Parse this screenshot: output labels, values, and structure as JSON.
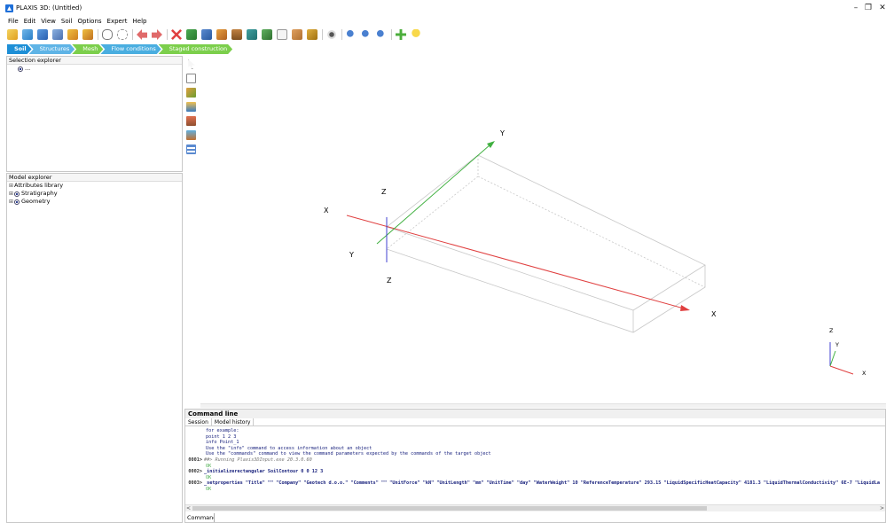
{
  "window": {
    "title": "PLAXIS 3D: (Untitled)",
    "minimize_glyph": "–",
    "restore_glyph": "❐",
    "close_glyph": "✕"
  },
  "menu": [
    "File",
    "Edit",
    "View",
    "Soil",
    "Options",
    "Expert",
    "Help"
  ],
  "toolbar": {
    "icons": [
      "new-project-icon",
      "open-project-icon",
      "save-icon",
      "save-as-icon",
      "import-icon",
      "export-icon",
      "link-icon",
      "unlink-icon",
      "undo-icon",
      "redo-icon",
      "delete-icon",
      "calculate-icon",
      "print-icon",
      "soil-icon",
      "borehole-icon",
      "structure-icon",
      "mesh-icon",
      "box-icon",
      "home-icon",
      "save-view-icon",
      "visibility-icon",
      "zoom-in-icon",
      "zoom-out-icon",
      "zoom-window-icon",
      "add-icon",
      "hint-icon"
    ]
  },
  "tabs": [
    {
      "label": "Soil",
      "color": "#29a0e0",
      "active": true
    },
    {
      "label": "Structures",
      "color": "#5fb4e6"
    },
    {
      "label": "Mesh",
      "color": "#7ccf4c"
    },
    {
      "label": "Flow conditions",
      "color": "#4aaee0"
    },
    {
      "label": "Staged construction",
      "color": "#7ccf4c"
    }
  ],
  "selection_explorer": {
    "title": "Selection explorer",
    "item": "..."
  },
  "model_explorer": {
    "title": "Model explorer",
    "items": [
      {
        "label": "Attributes library",
        "expander": "⊞"
      },
      {
        "label": "Stratigraphy",
        "expander": "⊞"
      },
      {
        "label": "Geometry",
        "expander": "⊞"
      }
    ]
  },
  "viewport": {
    "axis_labels": {
      "x_left": "X",
      "x_right": "X",
      "y_top": "Y",
      "y_bottom": "Y",
      "z_top": "Z",
      "z_bottom": "Z"
    },
    "triad": {
      "z": "Z",
      "y": "Y",
      "x": "X"
    },
    "colors": {
      "x_axis": "#e04040",
      "y_axis": "#40b040",
      "z_axis": "#4040d0",
      "box": "#c8c8c8"
    }
  },
  "command_line": {
    "title": "Command line",
    "tabs": [
      "Session",
      "Model history"
    ],
    "log": [
      {
        "num": "",
        "text": "for example:",
        "style": ""
      },
      {
        "num": "",
        "text": "  point 1 2 3",
        "style": ""
      },
      {
        "num": "",
        "text": "  info Point_1",
        "style": ""
      },
      {
        "num": "",
        "text": "Use the \"info\" command to access information about an object",
        "style": ""
      },
      {
        "num": "",
        "text": "Use the \"commands\" command to view the command parameters expected by the commands of the target object",
        "style": ""
      },
      {
        "num": "0001>",
        "text": "##> Running Plaxis3DInput.exe 20.3.0.60",
        "style": "ital"
      },
      {
        "num": "",
        "text": "OK",
        "style": "ok"
      },
      {
        "num": "0002>",
        "text": "_initializerectangular SoilContour 0 0 12 3",
        "style": "cmd"
      },
      {
        "num": "",
        "text": "OK",
        "style": "ok"
      },
      {
        "num": "0003>",
        "text": "_setproperties \"Title\" \"\" \"Company\" \"Geotech d.o.o.\" \"Comments\" \"\" \"UnitForce\" \"kN\" \"UnitLength\" \"mm\" \"UnitTime\" \"day\" \"WaterWeight\" 10 \"ReferenceTemperature\" 293.15 \"LiquidSpecificHeatCapacity\" 4181.3 \"LiquidThermalConductivity\" 6E-7 \"LiquidLa",
        "style": "cmd"
      },
      {
        "num": "",
        "text": "OK",
        "style": "ok"
      }
    ],
    "input_label": "Command",
    "input_value": ""
  }
}
